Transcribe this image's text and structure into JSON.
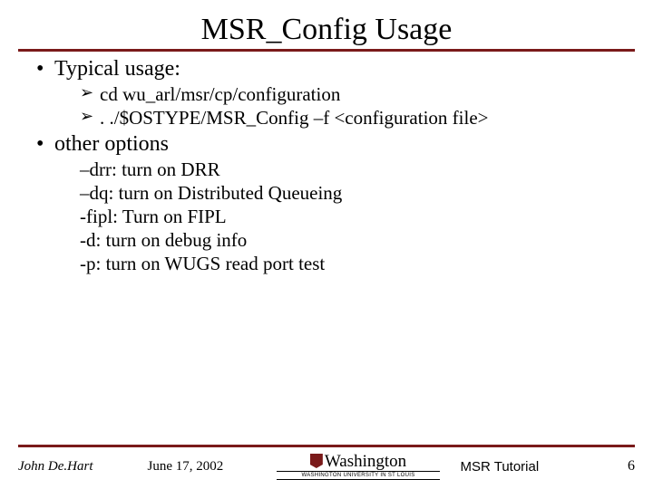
{
  "title": "MSR_Config Usage",
  "sections": [
    {
      "heading": "Typical usage:",
      "style": "arrow",
      "items": [
        "cd wu_arl/msr/cp/configuration",
        ". ./$OSTYPE/MSR_Config –f <configuration file>"
      ]
    },
    {
      "heading": "other options",
      "style": "dash",
      "items": [
        "–drr: turn on DRR",
        "–dq: turn on Distributed Queueing",
        "-fipl: Turn on FIPL",
        "-d: turn on debug info",
        "-p: turn on WUGS read port test"
      ]
    }
  ],
  "footer": {
    "author": "John De.Hart",
    "date": "June 17,  2002",
    "logo_main": "Washington",
    "logo_sub": "WASHINGTON UNIVERSITY IN ST LOUIS",
    "tutorial": "MSR Tutorial",
    "page": "6"
  }
}
